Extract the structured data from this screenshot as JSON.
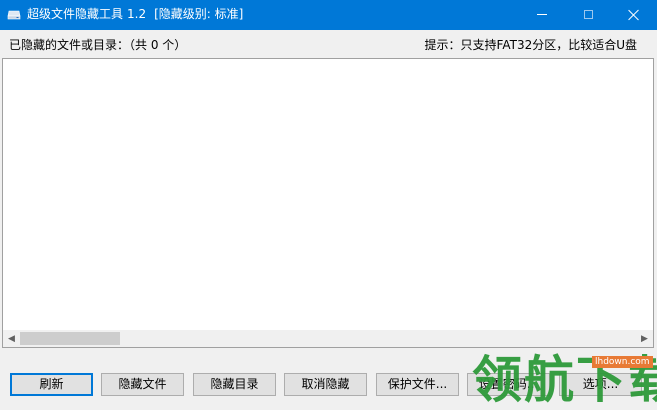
{
  "window": {
    "title": "超级文件隐藏工具",
    "version": "1.2",
    "level": "[隐藏级别: 标准]"
  },
  "info": {
    "list_header": "已隐藏的文件或目录：（共 0 个）",
    "hint": "提示：只支持FAT32分区，比较适合U盘"
  },
  "list": {
    "items": []
  },
  "buttons": {
    "refresh": "刷新",
    "hide_file": "隐藏文件",
    "hide_dir": "隐藏目录",
    "unhide": "取消隐藏",
    "protect_file": "保护文件...",
    "set_password": "设置密码...",
    "options": "选项..."
  },
  "watermark": {
    "text": "领航下载",
    "site": "lhdown.com"
  },
  "colors": {
    "titlebar": "#0078d7",
    "watermark_green": "#2e9a3a"
  }
}
